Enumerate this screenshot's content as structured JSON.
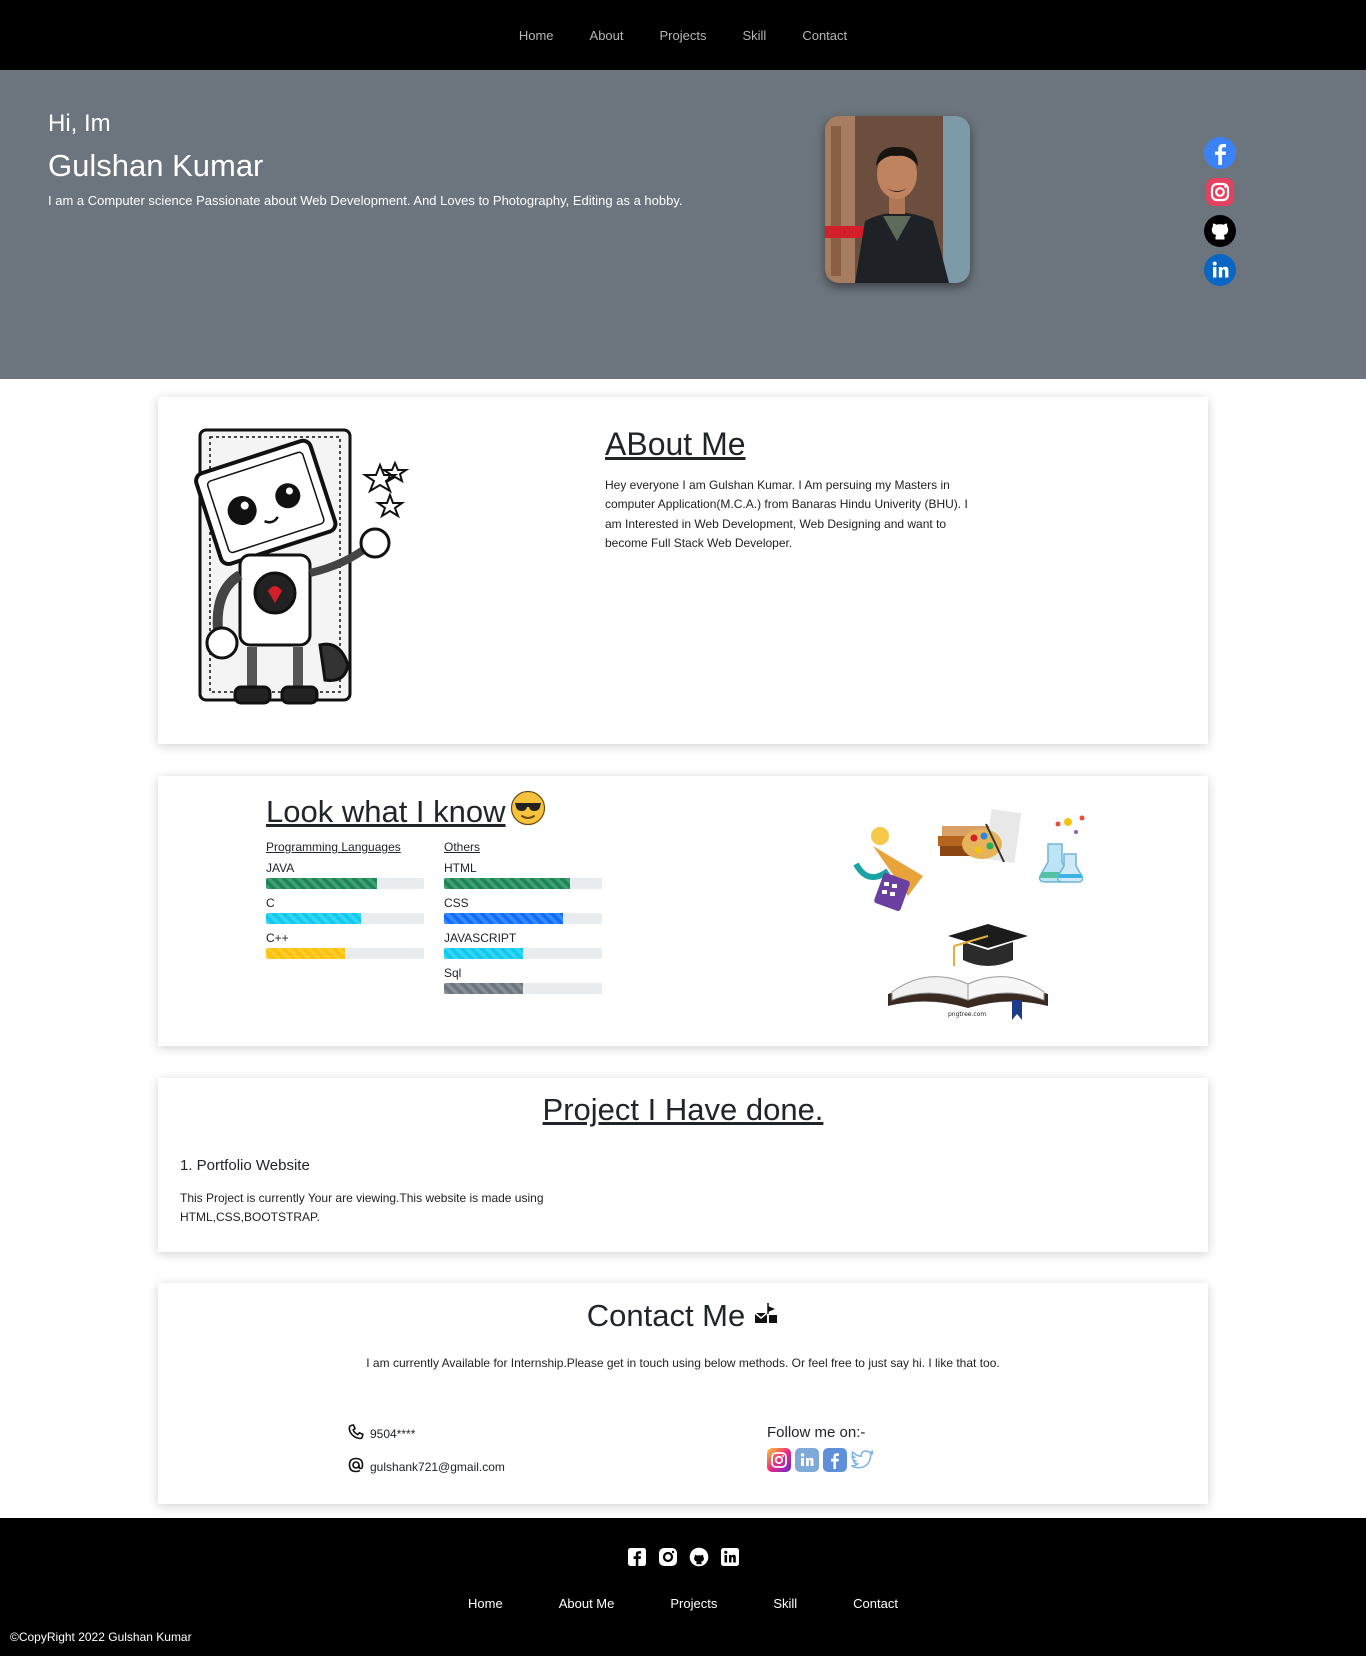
{
  "nav": {
    "items": [
      "Home",
      "About",
      "Projects",
      "Skill",
      "Contact"
    ]
  },
  "hero": {
    "greeting": "Hi, Im",
    "name": "Gulshan Kumar",
    "tagline": "I am a Computer science Passionate about Web Development. And Loves to Photography, Editing as a hobby.",
    "socials": [
      "facebook-icon",
      "instagram-icon",
      "github-icon",
      "linkedin-icon"
    ],
    "colors": {
      "background": "#6c757d",
      "facebook": "#3b82f6",
      "instagram": "#e4405f",
      "github": "#000000",
      "linkedin": "#0a66c2"
    }
  },
  "about": {
    "title": "ABout Me",
    "text": "Hey everyone I am Gulshan Kumar. I Am persuing my Masters in computer Application(M.C.A.) from Banaras Hindu Univerity (BHU). I am Interested in Web Development, Web Designing and want to become Full Stack Web Developer."
  },
  "skills": {
    "title": "Look what I know",
    "emoji": "😎",
    "programming": {
      "heading": "Programming Languages",
      "items": [
        {
          "label": "JAVA",
          "level": 0.7,
          "color": "#198754"
        },
        {
          "label": "C",
          "level": 0.6,
          "color": "#0dcaf0"
        },
        {
          "label": "C++",
          "level": 0.5,
          "color": "#ffc107"
        }
      ]
    },
    "others": {
      "heading": "Others",
      "items": [
        {
          "label": "HTML",
          "level": 0.8,
          "color": "#198754"
        },
        {
          "label": "CSS",
          "level": 0.75,
          "color": "#0d6efd"
        },
        {
          "label": "JAVASCRIPT",
          "level": 0.5,
          "color": "#0dcaf0"
        },
        {
          "label": "Sql",
          "level": 0.5,
          "color": "#6c757d"
        }
      ]
    },
    "illustration_caption": "pngtree.com"
  },
  "projects": {
    "title": "Project I Have done.",
    "item_title": "1. Portfolio Website",
    "item_text": "This Project is currently Your are viewing.This website is made using HTML,CSS,BOOTSTRAP."
  },
  "contact": {
    "title": "Contact Me",
    "title_emoji": "📩",
    "intro": "I am currently Available for Internship.Please get in touch using below methods. Or feel free to just say hi. I like that too.",
    "phone": "9504****",
    "email": "gulshank721@gmail.com",
    "follow_label": "Follow me on:-",
    "follow_icons": [
      "instagram-icon",
      "linkedin-icon",
      "facebook-icon",
      "twitter-icon"
    ]
  },
  "footer": {
    "icons": [
      "facebook-icon",
      "instagram-icon",
      "github-icon",
      "linkedin-icon"
    ],
    "nav": [
      "Home",
      "About Me",
      "Projects",
      "Skill",
      "Contact"
    ],
    "copyright": "©CopyRight 2022 Gulshan Kumar"
  }
}
